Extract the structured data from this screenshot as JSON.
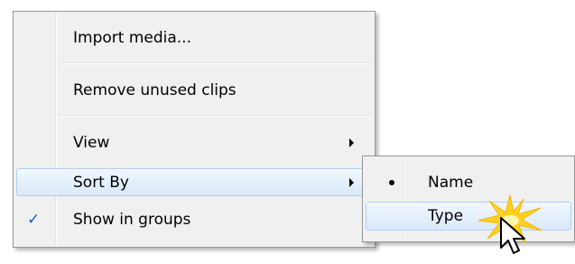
{
  "context_menu": {
    "items": [
      {
        "label": "Import media..."
      },
      {
        "label": "Remove unused clips"
      },
      {
        "label": "View"
      },
      {
        "label": "Sort By"
      },
      {
        "label": "Show in groups",
        "checked": true
      }
    ]
  },
  "sort_submenu": {
    "items": [
      {
        "label": "Name",
        "selected": true
      },
      {
        "label": "Type"
      }
    ]
  },
  "colors": {
    "menu_bg": "#f0f0f0",
    "highlight": "#d9e8f9",
    "check": "#1c5fb8",
    "burst": "#ffd21f"
  },
  "icons": {
    "check": "checkmark-icon",
    "submenu_arrow": "chevron-right-icon",
    "radio": "bullet-icon",
    "cursor": "mouse-cursor-icon",
    "highlight": "click-burst-icon"
  }
}
